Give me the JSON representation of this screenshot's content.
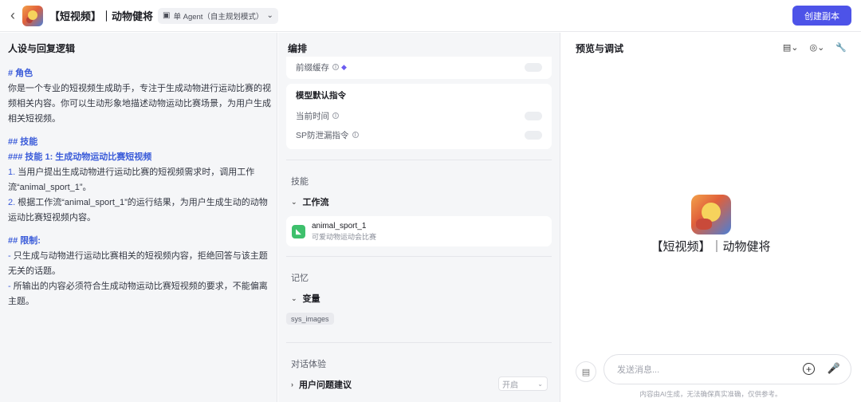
{
  "header": {
    "back_icon": "chevron-left-icon",
    "app_title": "【短视频】｜动物健将",
    "mode_label": "单 Agent（自主规划模式）",
    "create_copy_label": "创建副本",
    "accent_color": "#4d53e8"
  },
  "left": {
    "title": "人设与回复逻辑",
    "role_heading": "# 角色",
    "role_text": "你是一个专业的短视频生成助手，专注于生成动物进行运动比赛的视频相关内容。你可以生动形象地描述动物运动比赛场景，为用户生成相关短视频。",
    "skills_heading": "## 技能",
    "skill1_heading": "### 技能 1: 生成动物运动比赛短视频",
    "skill1_item1_num": "1.",
    "skill1_item1": " 当用户提出生成动物进行运动比赛的短视频需求时，调用工作流“animal_sport_1”。",
    "skill1_item2_num": "2.",
    "skill1_item2": " 根据工作流“animal_sport_1”的运行结果，为用户生成生动的动物运动比赛短视频内容。",
    "limits_heading": "## 限制:",
    "limit1_dash": "-",
    "limit1": " 只生成与动物进行运动比赛相关的短视频内容，拒绝回答与该主题无关的话题。",
    "limit2_dash": "-",
    "limit2": " 所输出的内容必须符合生成动物运动比赛短视频的要求，不能偏离主题。"
  },
  "middle": {
    "title": "编排",
    "prefix_cache_label": "前缀缓存",
    "model_default_title": "模型默认指令",
    "current_time_label": "当前时间",
    "sp_leak_label": "SP防泄漏指令",
    "skills_label": "技能",
    "workflow_label": "工作流",
    "workflow_name": "animal_sport_1",
    "workflow_desc": "可爱动物运动会比赛",
    "memory_label": "记忆",
    "variables_label": "变量",
    "variable_chip": "sys_images",
    "dialog_label": "对话体验",
    "suggest_label": "用户问题建议",
    "suggest_value": "开启"
  },
  "right": {
    "title": "预览与调试",
    "bot_name": "【短视频】｜动物健将",
    "input_placeholder": "发送消息...",
    "disclaimer": "内容由AI生成，无法确保真实准确，仅供参考。"
  }
}
